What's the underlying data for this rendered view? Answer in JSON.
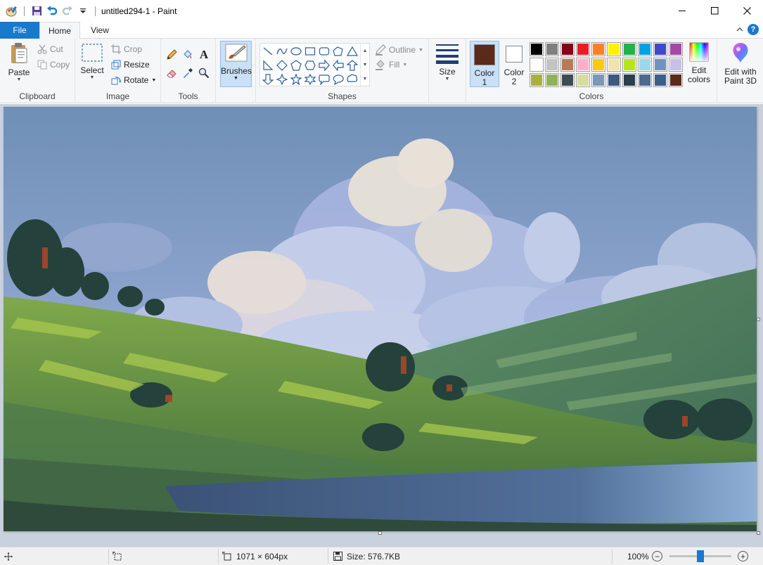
{
  "window": {
    "title": "untitled294-1 - Paint"
  },
  "tabs": [
    {
      "label": "File"
    },
    {
      "label": "Home"
    },
    {
      "label": "View"
    }
  ],
  "clipboard": {
    "paste_label": "Paste",
    "cut_label": "Cut",
    "copy_label": "Copy",
    "group_label": "Clipboard"
  },
  "image": {
    "select_label": "Select",
    "crop_label": "Crop",
    "resize_label": "Resize",
    "rotate_label": "Rotate",
    "group_label": "Image"
  },
  "tools": {
    "group_label": "Tools"
  },
  "brushes": {
    "label": "Brushes"
  },
  "shapes": {
    "outline_label": "Outline",
    "fill_label": "Fill",
    "group_label": "Shapes"
  },
  "size": {
    "label": "Size"
  },
  "colors": {
    "color1_label": "Color 1",
    "color2_label": "Color 2",
    "color1_value": "#5b2a1a",
    "color2_value": "#ffffff",
    "edit_colors_label": "Edit colors",
    "paint3d_label": "Edit with Paint 3D",
    "group_label": "Colors",
    "palette": [
      "#000000",
      "#7f7f7f",
      "#880015",
      "#ed1c24",
      "#ff7f27",
      "#fff200",
      "#22b14c",
      "#00a2e8",
      "#3f48cc",
      "#a349a4",
      "#ffffff",
      "#c3c3c3",
      "#b97a57",
      "#ffaec9",
      "#ffc90e",
      "#efe4b0",
      "#b5e61d",
      "#99d9ea",
      "#7092be",
      "#c8bfe7",
      "#a8b13f",
      "#8fb35a",
      "#3d4b52",
      "#d7dd9e",
      "#7a98b8",
      "#3c5a7e",
      "#2c3e4e",
      "#4a6a90",
      "#3a5f8a",
      "#5b2a1a"
    ]
  },
  "status": {
    "dimensions": "1071 × 604px",
    "size": "Size: 576.7KB",
    "zoom": "100%",
    "zoom_fraction": 0.5
  }
}
